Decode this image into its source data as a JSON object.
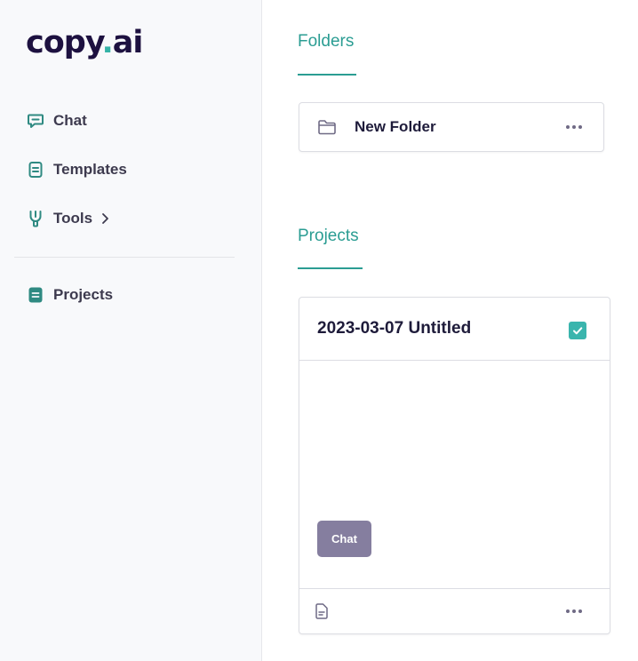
{
  "brand": {
    "logo_left": "copy",
    "logo_dot": ".",
    "logo_right": "ai"
  },
  "sidebar": {
    "items": [
      {
        "label": "Chat",
        "icon": "chat-icon"
      },
      {
        "label": "Templates",
        "icon": "template-icon"
      },
      {
        "label": "Tools",
        "icon": "tools-icon",
        "has_submenu": true
      },
      {
        "label": "Projects",
        "icon": "projects-icon",
        "active": true
      }
    ]
  },
  "folders": {
    "title": "Folders",
    "items": [
      {
        "name": "New Folder",
        "icon": "folder-icon"
      }
    ]
  },
  "projects": {
    "title": "Projects",
    "items": [
      {
        "title": "2023-03-07 Untitled",
        "checked": true,
        "badge": "Chat"
      }
    ]
  },
  "colors": {
    "accent": "#2b9d93",
    "brand": "#1d1140",
    "badge": "#857e9f",
    "checkbox": "#3ab5ad"
  }
}
